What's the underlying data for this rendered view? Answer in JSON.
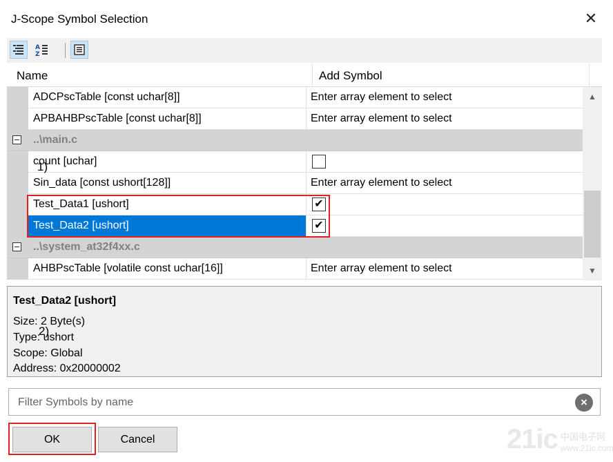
{
  "window": {
    "title": "J-Scope Symbol Selection",
    "close_glyph": "✕"
  },
  "toolbar": {
    "icons": [
      "categorized-icon",
      "sort-alpha-icon",
      "properties-icon"
    ]
  },
  "grid": {
    "columns": {
      "name": "Name",
      "add": "Add Symbol"
    },
    "rows": [
      {
        "name": "ADCPscTable [const uchar[8]]",
        "add": "Enter array element to select"
      },
      {
        "name": "APBAHBPscTable [const uchar[8]]",
        "add": "Enter array element to select"
      },
      {
        "group": "..\\main.c"
      },
      {
        "name": "count [uchar]",
        "checked": false
      },
      {
        "name": "Sin_data [const ushort[128]]",
        "add": "Enter array element to select"
      },
      {
        "name": "Test_Data1 [ushort]",
        "checked": true
      },
      {
        "name": "Test_Data2 [ushort]",
        "checked": true,
        "selected": true
      },
      {
        "group": "..\\system_at32f4xx.c"
      },
      {
        "name": "AHBPscTable [volatile const uchar[16]]",
        "add": "Enter array element to select"
      }
    ],
    "check_glyph": "✔"
  },
  "annotations": {
    "one": "1)",
    "two": "2)"
  },
  "info": {
    "title": "Test_Data2 [ushort]",
    "size": "Size:  2 Byte(s)",
    "type": "Type:  ushort",
    "scope": "Scope:  Global",
    "address": "Address: 0x20000002"
  },
  "filter": {
    "placeholder": "Filter Symbols by name",
    "value": ""
  },
  "buttons": {
    "ok": "OK",
    "cancel": "Cancel"
  },
  "watermark": {
    "logo": "21ic",
    "cn": "中国电子网",
    "url": "www.21ic.com"
  },
  "colors": {
    "selection": "#0078d7",
    "highlight": "#e02020",
    "group_bg": "#d4d4d4"
  }
}
